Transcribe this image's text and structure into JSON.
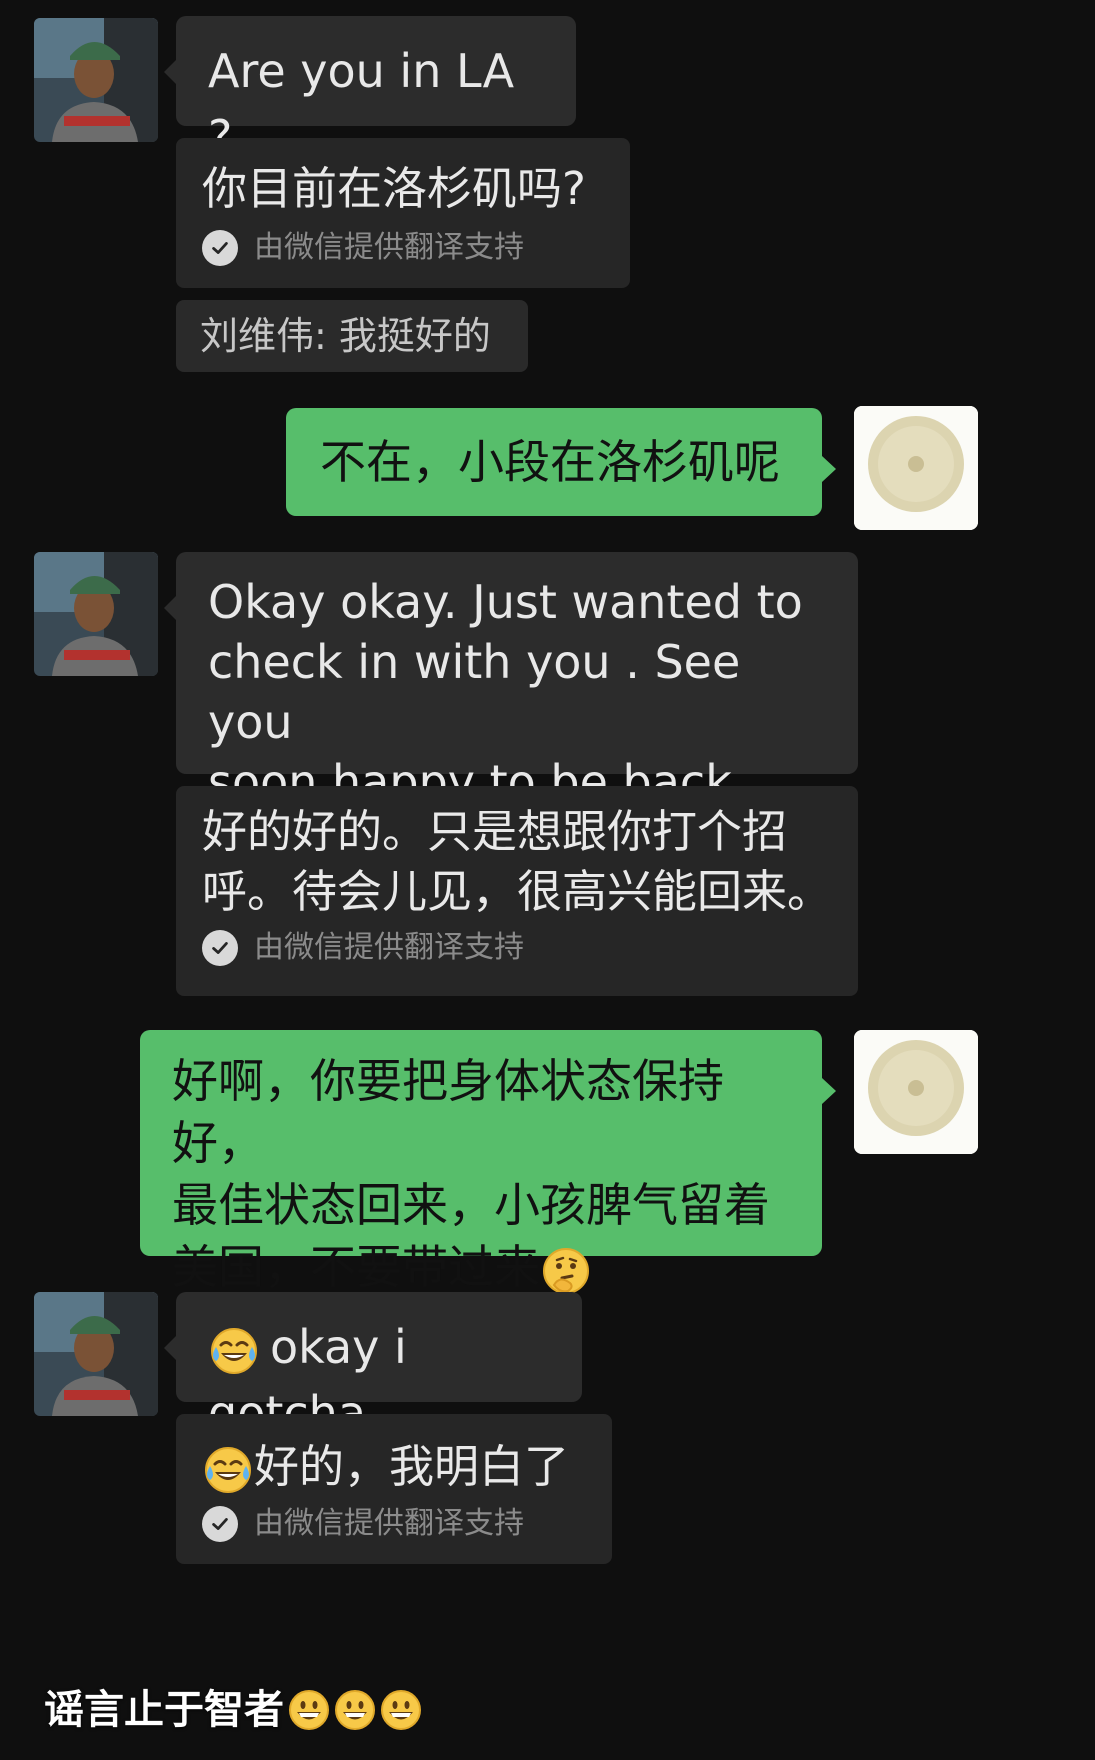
{
  "conversation": {
    "messages": [
      {
        "id": "m1",
        "from": "contact",
        "text": "Are you in LA ?",
        "translation": "你目前在洛杉矶吗?",
        "translation_provider": "由微信提供翻译支持"
      },
      {
        "id": "m2",
        "from": "contact",
        "quote": "刘维伟:  我挺好的"
      },
      {
        "id": "m3",
        "from": "me",
        "text": "不在，小段在洛杉矶呢"
      },
      {
        "id": "m4",
        "from": "contact",
        "text_lines": [
          "Okay okay. Just wanted to",
          "check in with you . See you",
          "soon happy to be back."
        ],
        "translation_lines": [
          "好的好的。只是想跟你打个招",
          "呼。待会儿见，很高兴能回来。"
        ],
        "translation_provider": "由微信提供翻译支持"
      },
      {
        "id": "m5",
        "from": "me",
        "text_lines": [
          "好啊，你要把身体状态保持好，",
          "最佳状态回来，小孩脾气留着",
          "美国，不要带过来"
        ],
        "emoji": "thinking-face"
      },
      {
        "id": "m6",
        "from": "contact",
        "emoji": "tears-of-joy",
        "text": "okay i gotcha",
        "translation": "好的，我明白了",
        "translation_provider": "由微信提供翻译支持"
      }
    ]
  },
  "watermark": {
    "text": "谣言止于智者",
    "emoji": "grinning-face",
    "emoji_count": 3
  }
}
